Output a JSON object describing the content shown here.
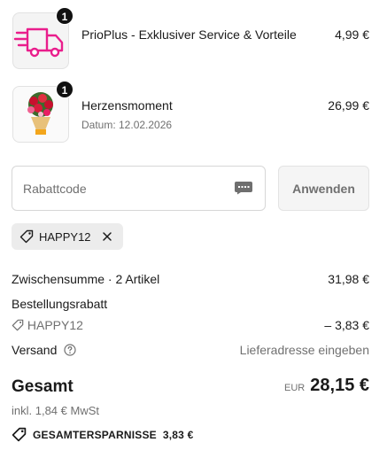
{
  "line_items": [
    {
      "name": "PrioPlus - Exklusiver Service & Vorteile",
      "price": "4,99 €",
      "quantity": "1",
      "meta": "",
      "icon": "delivery-truck-icon",
      "icon_color": "#e91e8c"
    },
    {
      "name": "Herzensmoment",
      "meta": "Datum: 12.02.2026",
      "price": "26,99 €",
      "quantity": "1",
      "icon": "flower-bouquet-image"
    }
  ],
  "discount": {
    "placeholder": "Rabattcode",
    "apply_label": "Anwenden",
    "applied_code": "HAPPY12"
  },
  "summary": {
    "subtotal_label": "Zwischensumme · 2 Artikel",
    "subtotal_value": "31,98 €",
    "order_discount_label": "Bestellungsrabatt",
    "order_discount_code": "HAPPY12",
    "order_discount_value": "– 3,83 €",
    "shipping_label": "Versand",
    "shipping_value": "Lieferadresse eingeben"
  },
  "total": {
    "label": "Gesamt",
    "currency": "EUR",
    "amount": "28,15 €",
    "tax_note": "inkl. 1,84 € MwSt",
    "savings_label": "GESAMTERSPARNISSE",
    "savings_value": "3,83 €"
  },
  "colors": {
    "accent_pink": "#e91e8c",
    "text": "#1a1a1a",
    "muted_text": "#707070",
    "badge": "#111111"
  }
}
